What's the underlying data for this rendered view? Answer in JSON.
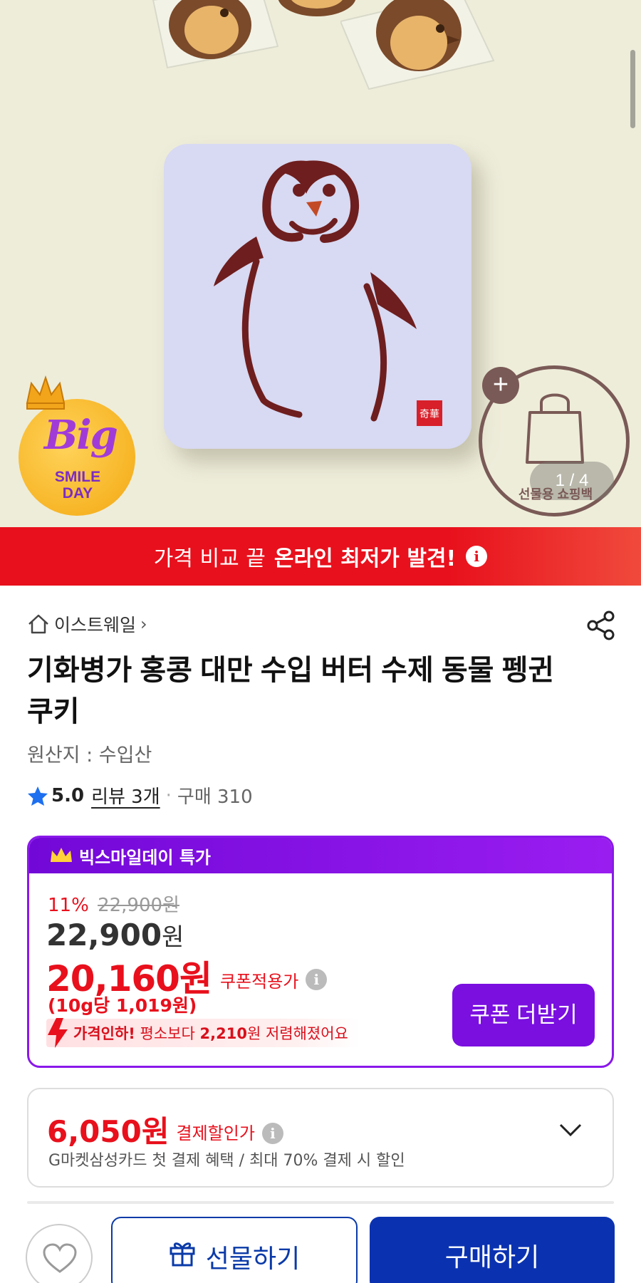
{
  "hero": {
    "image_alt": "Penguin cookie tin with individually wrapped penguin cookies",
    "badge": {
      "line1": "Big",
      "line2": "SMILE",
      "line3": "DAY"
    },
    "gift_label": "선물용 쇼핑백",
    "image_counter": "1 / 4"
  },
  "price_banner": {
    "light_text": "가격 비교 끝",
    "strong_text": "온라인 최저가 발견!",
    "info_icon": "i"
  },
  "store": {
    "name": "이스트웨일",
    "chevron": "›"
  },
  "product": {
    "title": "기화병가 홍콩 대만 수입 버터 수제 동물 펭귄 쿠키",
    "origin": "원산지 : 수입산",
    "rating": "5.0",
    "reviews": "리뷰 3개",
    "separator": "·",
    "purchases": "구매 310"
  },
  "deal": {
    "header": "빅스마일데이 특가",
    "discount_pct": "11%",
    "original_price": "22,900원",
    "price_num": "22,900",
    "price_unit": "원",
    "coupon_price": "20,160원",
    "coupon_label": "쿠폰적용가",
    "per_unit": "(10g당 1,019원)",
    "drop_text_bold1": "가격인하!",
    "drop_text_mid": "평소보다",
    "drop_text_bold2": "2,210",
    "drop_text_end": "원 저렴해졌어요",
    "coupon_button": "쿠폰 더받기",
    "colors": {
      "accent": "#7a0fe0",
      "price_red": "#e8101c"
    }
  },
  "payment": {
    "amount": "6,050원",
    "label": "결제할인가",
    "sub": "G마켓삼성카드 첫 결제 혜택 / 최대 70% 결제 시 할인"
  },
  "bottom_bar": {
    "gift_button": "선물하기",
    "buy_button": "구매하기",
    "colors": {
      "primary": "#0a32b0"
    }
  }
}
